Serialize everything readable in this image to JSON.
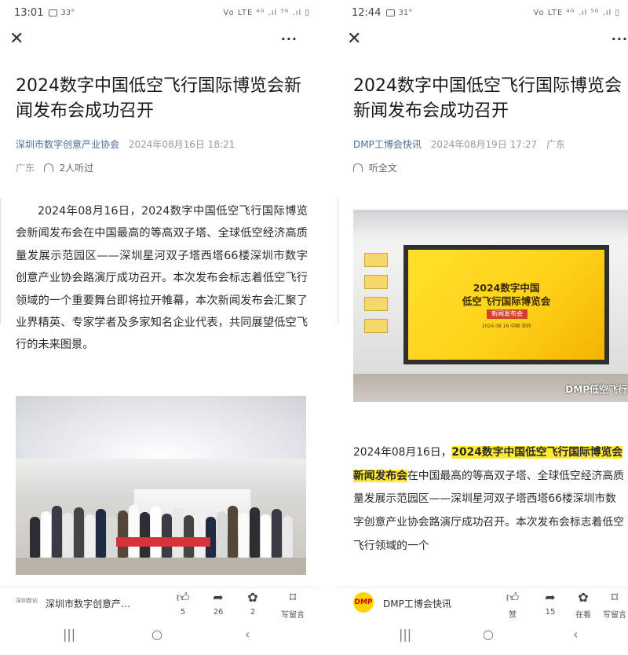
{
  "left": {
    "status": {
      "time": "13:01",
      "temp": "33°",
      "right": "Vo LTE ⁴ᴳ .ıl ⁵ᴳ .ıl ▯"
    },
    "title": "2024数字中国低空飞行国际博览会新闻发布会成功召开",
    "author": "深圳市数字创意产业协会",
    "date": "2024年08月16日 18:21",
    "region": "广东",
    "listeners": "2人听过",
    "paragraph": "2024年08月16日，2024数字中国低空飞行国际博览会新闻发布会在中国最高的等高双子塔、全球低空经济高质量发展示范园区——深圳星河双子塔西塔66楼深圳市数字创意产业协会路演厅成功召开。本次发布会标志着低空飞行领域的一个重要舞台即将拉开帷幕，本次新闻发布会汇聚了业界精英、专家学者及多家知名企业代表，共同展望低空飞行的未来图景。",
    "bottom": {
      "account_logo": "深圳数创",
      "account_name": "深圳市数字创意产…",
      "like_count": "5",
      "share_count": "26",
      "recommend_count": "2",
      "comment_label": "写留言"
    }
  },
  "right": {
    "status": {
      "time": "12:44",
      "temp": "31°",
      "right": "Vo LTE ⁴ᴳ .ıl ⁵ᴳ .ıl ▯"
    },
    "title": "2024数字中国低空飞行国际博览会新闻发布会成功召开",
    "author": "DMP工博会快讯",
    "date": "2024年08月19日 17:27",
    "region": "广东",
    "listen_label": "听全文",
    "screen_title_1": "2024数字中国",
    "screen_title_2": "低空飞行国际博览会",
    "screen_tag": "新闻发布会",
    "screen_small": "2024.08.16 中国·深圳",
    "watermark": "DMP低空飞行",
    "para_prefix": "2024年08月16日，",
    "para_highlight_1": "2024数字中国低空飞行国际",
    "para_highlight_2": "博览会新闻发布会",
    "para_rest": "在中国最高的等高双子塔、全球低空经济高质量发展示范园区——深圳星河双子塔西塔66楼深圳市数字创意产业协会路演厅成功召开。本次发布会标志着低空飞行领域的一个",
    "bottom": {
      "account_logo": "DMP",
      "account_name": "DMP工博会快讯",
      "like_label": "赞",
      "share_count": "15",
      "recommend_label": "在看",
      "comment_label": "写留言"
    }
  },
  "nav": {
    "recents": "|||",
    "home": "○",
    "back": "‹"
  }
}
